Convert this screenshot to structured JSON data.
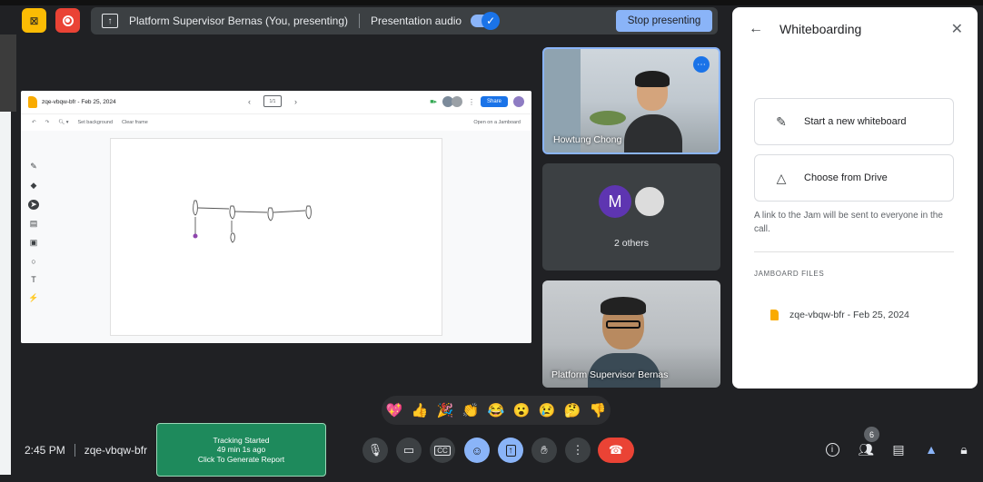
{
  "topbar": {
    "presenting_title": "Platform Supervisor Bernas (You, presenting)",
    "audio_label": "Presentation audio",
    "stop_label": "Stop presenting"
  },
  "jamboard": {
    "title": "zqe-vbqw-bfr - Feb 25, 2024",
    "share_label": "Share",
    "set_background": "Set background",
    "clear_frame": "Clear frame",
    "open_on_jamboard": "Open on a Jamboard",
    "frame_counter": "1/1"
  },
  "tiles": {
    "tile1_name": "Howtung Chong",
    "others_initial": "M",
    "others_label": "2 others",
    "tile3_name": "Platform Supervisor Bernas"
  },
  "panel": {
    "title": "Whiteboarding",
    "option_new": "Start a new whiteboard",
    "option_drive": "Choose from Drive",
    "note": "A link to the Jam will be sent to everyone in the call.",
    "files_label": "JAMBOARD FILES",
    "file_name": "zqe-vbqw-bfr - Feb 25, 2024"
  },
  "reactions": [
    "💖",
    "👍",
    "🎉",
    "👏",
    "😂",
    "😮",
    "😢",
    "🤔",
    "👎"
  ],
  "bottom": {
    "time": "2:45 PM",
    "meeting_code": "zqe-vbqw-bfr",
    "tracking_line1": "Tracking Started",
    "tracking_line2": "49 min 1s ago",
    "tracking_line3": "Click To Generate Report",
    "people_count": "6"
  },
  "colors": {
    "accent_blue": "#8ab4f8",
    "end_call_red": "#ea4335",
    "tracking_green": "#1e8a5c",
    "jamboard_yellow": "#f9ab00"
  }
}
